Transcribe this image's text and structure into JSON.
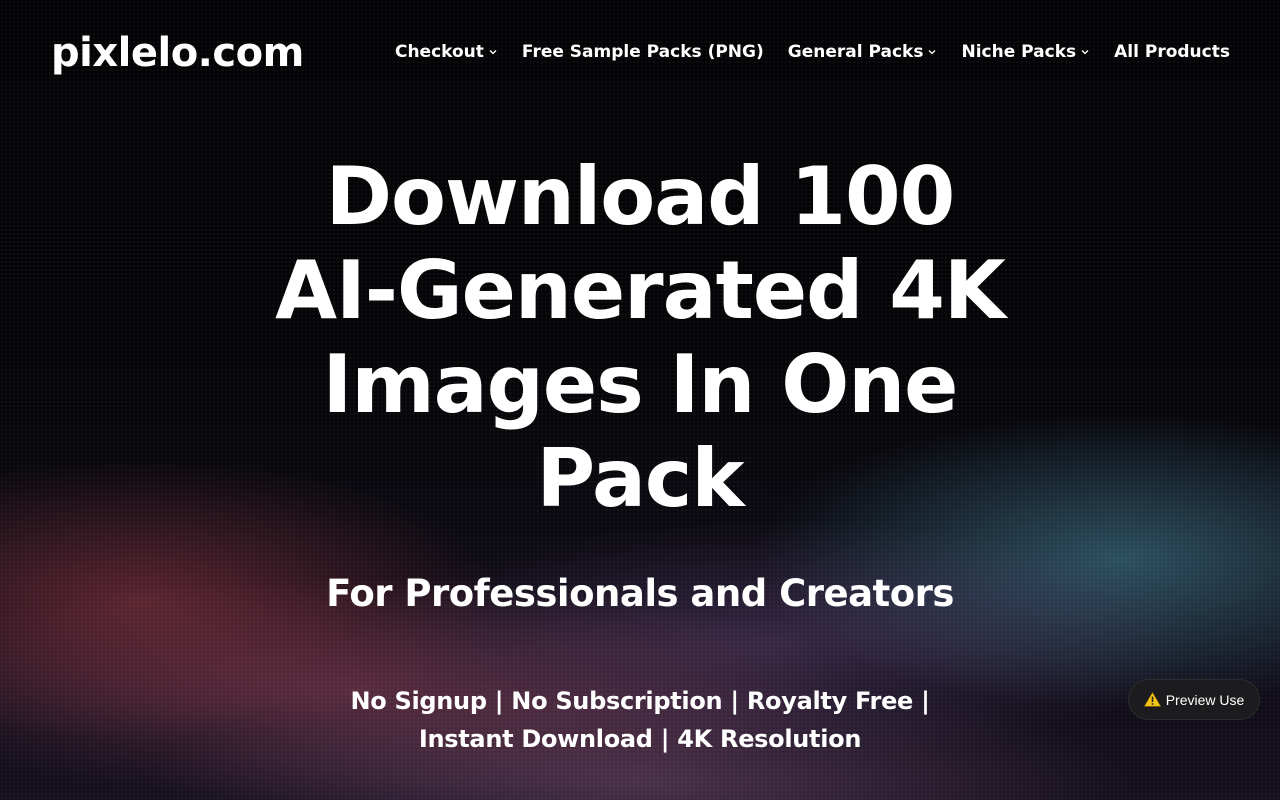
{
  "site": {
    "logo": "pixlelo.com"
  },
  "nav": {
    "items": [
      {
        "label": "Checkout",
        "has_dropdown": true
      },
      {
        "label": "Free Sample Packs (PNG)",
        "has_dropdown": false
      },
      {
        "label": "General Packs",
        "has_dropdown": true
      },
      {
        "label": "Niche Packs",
        "has_dropdown": true
      },
      {
        "label": "All Products",
        "has_dropdown": false
      }
    ]
  },
  "hero": {
    "headline": "Download 100 AI-Generated 4K Images In One Pack",
    "subheadline": "For Professionals and Creators",
    "features": "No Signup | No Subscription | Royalty Free | Instant Download | 4K Resolution"
  },
  "preview_badge": {
    "label": "Preview Use",
    "icon": "warning-icon",
    "icon_color": "#f5c518"
  },
  "colors": {
    "text": "#ffffff",
    "background": "#050507",
    "badge_bg": "#1c1c1e"
  }
}
